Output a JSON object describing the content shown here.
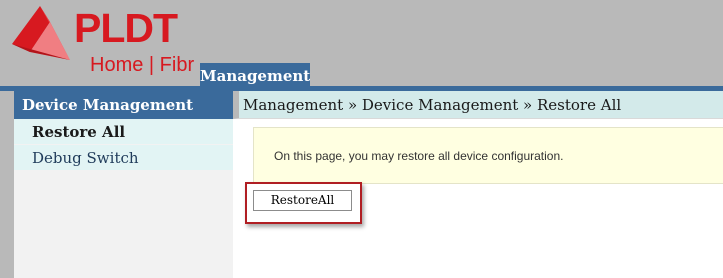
{
  "header": {
    "brand": "PLDT",
    "brand_sub": "Home | Fibr",
    "active_tab": "Management",
    "colors": {
      "brand": "#d71920",
      "nav": "#3a6a9b"
    }
  },
  "sidebar": {
    "title": "Device Management",
    "items": [
      {
        "label": "Restore All",
        "active": true
      },
      {
        "label": "Debug Switch",
        "active": false
      }
    ]
  },
  "main": {
    "breadcrumb": "Management » Device Management » Restore All",
    "notice": "On this page, you may restore all device configuration.",
    "restore_button": "RestoreAll"
  }
}
